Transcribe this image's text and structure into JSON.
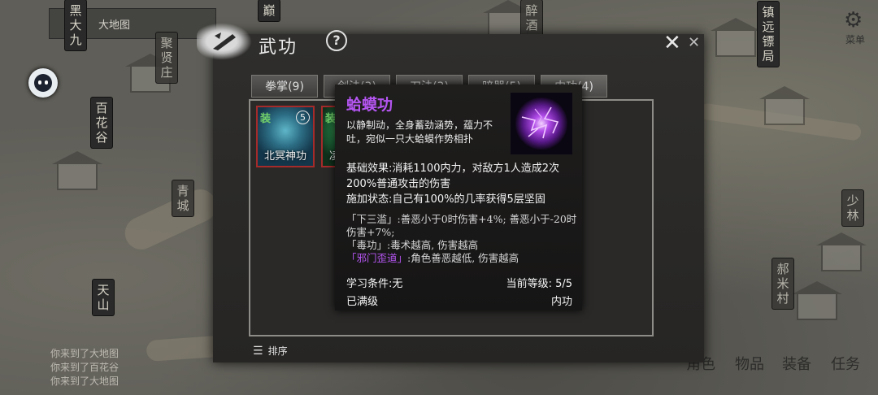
{
  "map": {
    "top_banner": "大地图",
    "places": [
      {
        "name": "黑大九",
        "dim": false
      },
      {
        "name": "聚贤庄",
        "dim": true
      },
      {
        "name": "百花谷",
        "dim": false
      },
      {
        "name": "青城",
        "dim": true
      },
      {
        "name": "天山",
        "dim": false
      },
      {
        "name": "醉酒",
        "dim": true
      },
      {
        "name": "镇远镖局",
        "dim": false
      },
      {
        "name": "少林",
        "dim": true
      },
      {
        "name": "郝米村",
        "dim": true
      },
      {
        "name": "巅",
        "dim": false
      }
    ],
    "messages": [
      "你来到了大地图",
      "你来到了百花谷",
      "你来到了大地图"
    ],
    "bottom_menu": [
      "角色",
      "物品",
      "装备",
      "任务"
    ],
    "settings_label": "菜单"
  },
  "panel": {
    "title": "武功",
    "help_symbol": "?",
    "close_symbol": "✕",
    "tabs": [
      {
        "label": "拳掌(9)"
      },
      {
        "label": "剑法(3)"
      },
      {
        "label": "刀法(3)"
      },
      {
        "label": "暗器(5)"
      },
      {
        "label": "内功(4)"
      }
    ],
    "skills": [
      {
        "name": "北冥神功",
        "equip_tag": "装",
        "level": "5"
      },
      {
        "name": "凌波微步",
        "equip_tag": "装",
        "level": ""
      }
    ],
    "sort_label": "排序"
  },
  "tooltip": {
    "name": "蛤蟆功",
    "description": "以静制动，全身蓄劲涵势，蕴力不吐，宛似一只大蛤蟆作势相扑",
    "base_effect": "基础效果:消耗1100内力，对敌方1人造成2次200%普通攻击的伤害",
    "status_effect": "施加状态:自己有100%的几率获得5层坚固",
    "traits": [
      {
        "tag": "「下三滥」",
        "text": ":善恶小于0时伤害+4%; 善恶小于-20时伤害+7%;",
        "highlight": false
      },
      {
        "tag": "「毒功」",
        "text": ":毒术越高, 伤害越高",
        "highlight": false
      },
      {
        "tag": "「邪门歪道」",
        "text": ":角色善恶越低, 伤害越高",
        "highlight": true
      }
    ],
    "requirement": "学习条件:无",
    "current_level": "当前等级: 5/5",
    "max_status": "已满级",
    "category": "内功",
    "accent_color": "#b455f0"
  }
}
